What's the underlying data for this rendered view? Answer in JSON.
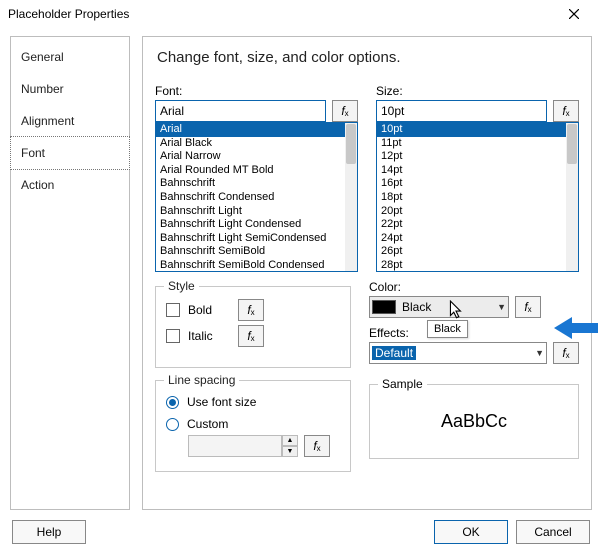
{
  "window": {
    "title": "Placeholder Properties"
  },
  "sidebar": {
    "items": [
      {
        "label": "General"
      },
      {
        "label": "Number"
      },
      {
        "label": "Alignment"
      },
      {
        "label": "Font"
      },
      {
        "label": "Action"
      }
    ],
    "selected_index": 3
  },
  "heading": "Change font, size, and color options.",
  "font": {
    "label": "Font:",
    "value": "Arial",
    "options": [
      "Arial",
      "Arial Black",
      "Arial Narrow",
      "Arial Rounded MT Bold",
      "Bahnschrift",
      "Bahnschrift Condensed",
      "Bahnschrift Light",
      "Bahnschrift Light Condensed",
      "Bahnschrift Light SemiCondensed",
      "Bahnschrift SemiBold",
      "Bahnschrift SemiBold Condensed"
    ],
    "selected_index": 0
  },
  "size": {
    "label": "Size:",
    "value": "10pt",
    "options": [
      "10pt",
      "11pt",
      "12pt",
      "14pt",
      "16pt",
      "18pt",
      "20pt",
      "22pt",
      "24pt",
      "26pt",
      "28pt"
    ],
    "selected_index": 0
  },
  "style": {
    "legend": "Style",
    "bold": "Bold",
    "italic": "Italic"
  },
  "linespacing": {
    "legend": "Line spacing",
    "use_font_size": "Use font size",
    "custom": "Custom"
  },
  "color": {
    "label": "Color:",
    "value": "Black",
    "tooltip": "Black"
  },
  "effects": {
    "label": "Effects:",
    "value": "Default"
  },
  "sample": {
    "legend": "Sample",
    "text": "AaBbCc"
  },
  "buttons": {
    "help": "Help",
    "ok": "OK",
    "cancel": "Cancel"
  },
  "fx_label": "fx"
}
